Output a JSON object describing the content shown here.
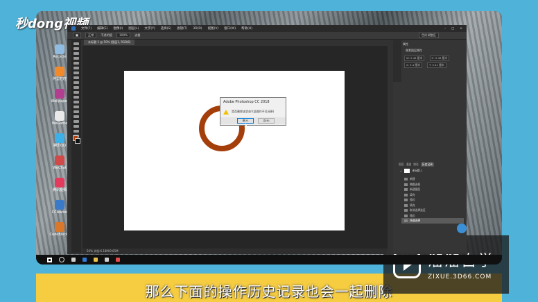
{
  "brand": {
    "top_left": "秒dong视频"
  },
  "watermark": {
    "name": "溜溜自学",
    "url": "ZIXUE.3D66.COM"
  },
  "subtitle": "那么下面的操作历史记录也会一起删除",
  "photoshop": {
    "doc_tab": "未标题-1 @ 50% (图层1, RGB/8)",
    "status": "50%   文档:6.18M/9.65M",
    "menu": [
      "文件(F)",
      "编辑(E)",
      "图像(I)",
      "图层(L)",
      "文字(Y)",
      "选择(S)",
      "滤镜(T)",
      "3D(D)",
      "视图(V)",
      "窗口(W)",
      "帮助(H)"
    ],
    "options": {
      "mode": "正常",
      "opacity": "不透明度",
      "flow": "流量",
      "preset": "色阶调整区"
    },
    "colors": {
      "foreground": "#b5420d",
      "background": "#111111"
    },
    "properties": {
      "title": "属性",
      "subtitle": "像素图层属性",
      "w": "W: 5.48 厘米",
      "h": "H: 5.48 厘米",
      "x": "X: 5.4 厘米",
      "y": "Y: 5.41 厘米"
    },
    "history_tabs": [
      "图层",
      "通道",
      "路径",
      "历史记录"
    ],
    "history_snapshot": "未标题-1",
    "history_items": [
      "新建",
      "椭圆选框",
      "新建图层",
      "填充",
      "描边",
      "填充",
      "取消选择选区",
      "描边",
      "快速选择"
    ],
    "dialog": {
      "title": "Adobe Photoshop CC 2018",
      "message": "是否删除该状态?(此操作不可还原)",
      "yes": "是(Y)",
      "no": "否(N)"
    }
  },
  "desktop_icons": [
    "Recycle",
    "阿里旺旺",
    "Wallpaper",
    "WeGame",
    "腾讯QQ",
    "WeChat",
    "腾讯视频",
    "CCleaner",
    "CodeBlocks"
  ]
}
